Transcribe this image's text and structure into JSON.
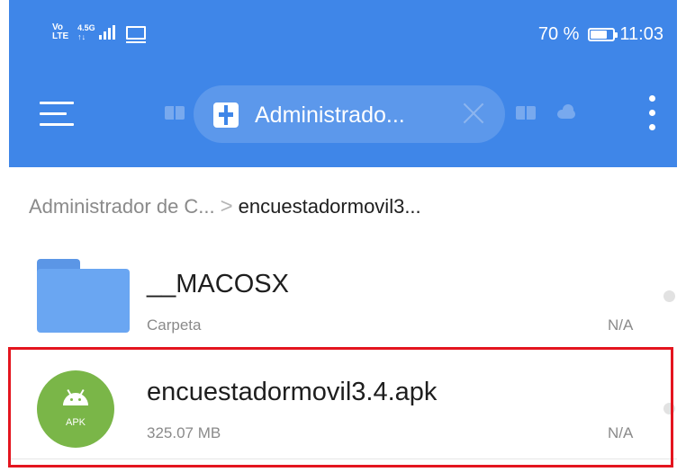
{
  "status_bar": {
    "network_top": "Vo",
    "network_bottom": "LTE",
    "network_speed_top": "4.5G",
    "network_speed_bottom": "↑↓",
    "battery_percent": "70 %",
    "battery_level": 0.7,
    "time": "11:03"
  },
  "toolbar": {
    "tab_label": "Administrado..."
  },
  "breadcrumb": {
    "root": "Administrador de C...",
    "separator": ">",
    "current": "encuestadormovil3..."
  },
  "files": [
    {
      "name": "__MACOSX",
      "meta": "Carpeta",
      "size": "N/A",
      "type": "folder"
    },
    {
      "name": "encuestadormovil3.4.apk",
      "meta": "325.07 MB",
      "size": "N/A",
      "type": "apk",
      "icon_label": "APK"
    }
  ],
  "colors": {
    "header": "#3f86e8",
    "highlight": "#e4151f",
    "apk_icon": "#7ab648",
    "folder": "#6aa6f2"
  }
}
